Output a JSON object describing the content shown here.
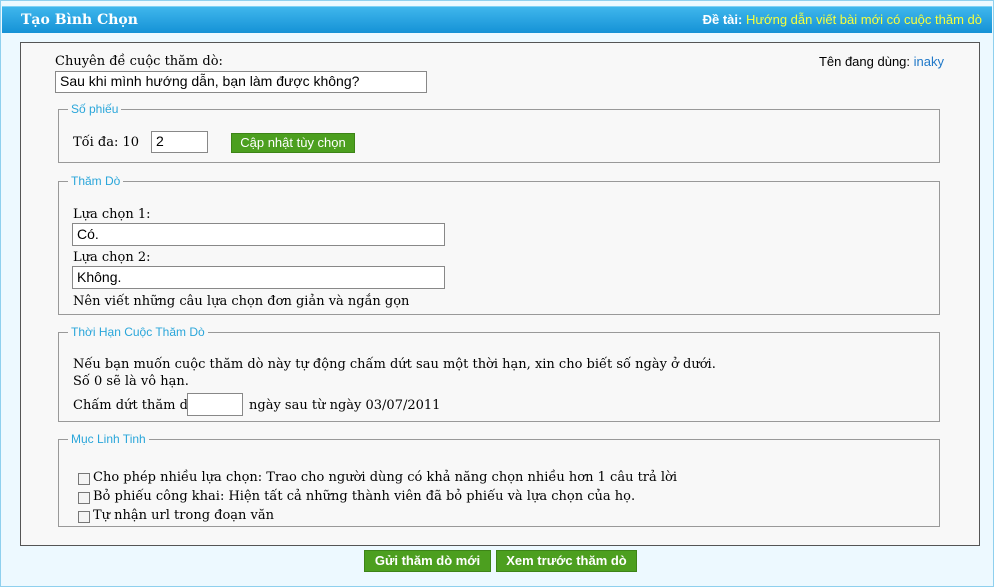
{
  "header": {
    "title": "Tạo Bình Chọn",
    "topic_label": "Đề tài:",
    "topic_link": "Hướng dẫn viết bài mới có cuộc thăm dò"
  },
  "topic_field": {
    "label": "Chuyên đề cuộc thăm dò:",
    "value": "Sau khi mình hướng dẫn, bạn làm được không?"
  },
  "user": {
    "label": "Tên đang dùng:",
    "name": "inaky"
  },
  "vote_count": {
    "legend": "Số phiếu",
    "max_label": "Tối đa: 10",
    "value": "2",
    "update_button": "Cập nhật tùy chọn"
  },
  "poll": {
    "legend": "Thăm Dò",
    "options": [
      {
        "label": "Lựa chọn 1:",
        "value": "Có."
      },
      {
        "label": "Lựa chọn 2:",
        "value": "Không."
      }
    ],
    "hint": "Nên viết những câu lựa chọn đơn giản và ngắn gọn"
  },
  "duration": {
    "legend": "Thời Hạn Cuộc Thăm Dò",
    "line1": "Nếu bạn muốn cuộc thăm dò này tự động chấm dứt sau một thời hạn, xin cho biết số ngày ở dưới.",
    "line2": "Số 0 sẽ là vô hạn.",
    "end_label": "Chấm dứt thăm dò",
    "end_value": "",
    "after_label": "ngày sau từ ngày 03/07/2011"
  },
  "misc": {
    "legend": "Mục Linh Tinh",
    "options": [
      {
        "label": "Cho phép nhiều lựa chọn: Trao cho người dùng có khả năng chọn nhiều hơn 1 câu trả lời",
        "checked": false
      },
      {
        "label": "Bỏ phiếu công khai: Hiện tất cả những thành viên đã bỏ phiếu và lựa chọn của họ.",
        "checked": false
      },
      {
        "label": "Tự nhận url trong đoạn văn",
        "checked": false
      }
    ]
  },
  "actions": {
    "submit": "Gửi thăm dò mới",
    "preview": "Xem trước thăm dò"
  }
}
